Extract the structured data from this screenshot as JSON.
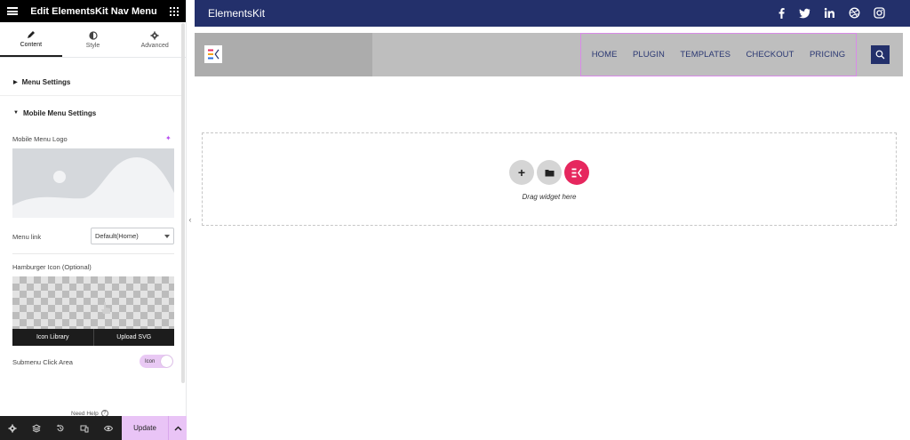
{
  "panel": {
    "title": "Edit ElementsKit Nav Menu",
    "tabs": [
      {
        "label": "Content",
        "icon": "pencil-icon"
      },
      {
        "label": "Style",
        "icon": "half-circle-icon"
      },
      {
        "label": "Advanced",
        "icon": "gear-icon"
      }
    ],
    "sections": {
      "menu_settings": "Menu Settings",
      "mobile_menu_settings": "Mobile Menu Settings"
    },
    "controls": {
      "mobile_logo_label": "Mobile Menu Logo",
      "menu_link_label": "Menu link",
      "menu_link_value": "Default(Home)",
      "hamburger_label": "Hamburger Icon (Optional)",
      "icon_library": "Icon Library",
      "upload_svg": "Upload SVG",
      "submenu_click_area_label": "Submenu Click Area",
      "submenu_click_area_value": "Icon"
    },
    "need_help": "Need Help",
    "footer": {
      "update": "Update"
    }
  },
  "preview": {
    "brand": "ElementsKit",
    "social": [
      "facebook-icon",
      "twitter-icon",
      "linkedin-icon",
      "dribbble-icon",
      "instagram-icon"
    ],
    "nav_items": [
      "HOME",
      "PLUGIN",
      "TEMPLATES",
      "CHECKOUT",
      "PRICING"
    ],
    "drop_text": "Drag widget here"
  },
  "colors": {
    "topbar": "#23306b",
    "accent_pink": "#e6275e",
    "update_button": "#e9c4f6"
  }
}
